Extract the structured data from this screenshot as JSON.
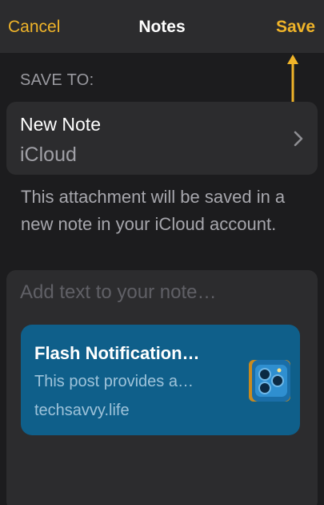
{
  "navbar": {
    "cancel_label": "Cancel",
    "title": "Notes",
    "save_label": "Save"
  },
  "colors": {
    "accent": "#f0b429",
    "background": "#1c1c1e",
    "card": "#2c2c2e",
    "link_card": "#0f5f8a"
  },
  "save_to": {
    "label": "SAVE TO:",
    "destination_title": "New Note",
    "destination_account": "iCloud",
    "chevron_icon": "chevron-right-icon"
  },
  "info": {
    "text": "This attachment will be saved in a new note in your iCloud account."
  },
  "note": {
    "placeholder": "Add text to your note…",
    "value": ""
  },
  "attachment": {
    "title": "Flash Notification…",
    "description": "This post provides a…",
    "domain": "techsavvy.life",
    "thumbnail_icon": "phone-camera-thumbnail"
  }
}
